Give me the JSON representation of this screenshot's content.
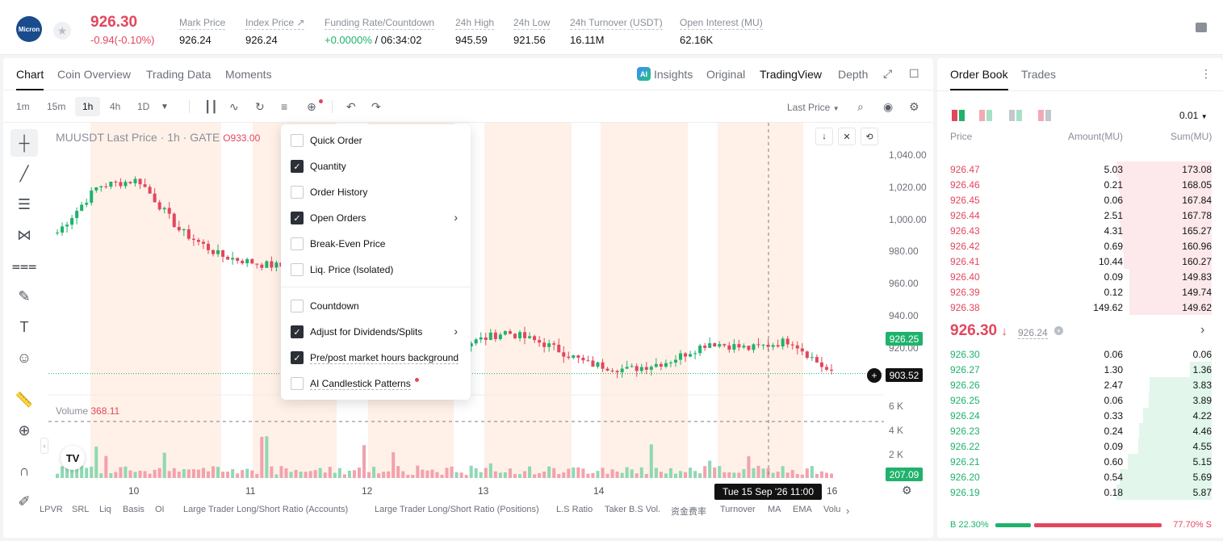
{
  "header": {
    "logo_text": "Micron",
    "price": "926.30",
    "change": "-0.94(-0.10%)",
    "stats": [
      {
        "label": "Mark Price",
        "value": "926.24"
      },
      {
        "label": "Index Price ↗",
        "value": "926.24"
      },
      {
        "label": "Funding Rate/Countdown",
        "value_green": "+0.0000%",
        "value": " / 06:34:02"
      },
      {
        "label": "24h High",
        "value": "945.59"
      },
      {
        "label": "24h Low",
        "value": "921.56"
      },
      {
        "label": "24h Turnover (USDT)",
        "value": "16.11M"
      },
      {
        "label": "Open Interest (MU)",
        "value": "62.16K"
      }
    ]
  },
  "chart_tabs": [
    "Chart",
    "Coin Overview",
    "Trading Data",
    "Moments"
  ],
  "chart_tabs_right": {
    "ai": "AI",
    "insights": "Insights",
    "original": "Original",
    "tradingview": "TradingView",
    "depth": "Depth"
  },
  "timeframes": [
    "1m",
    "15m",
    "1h",
    "4h",
    "1D"
  ],
  "last_price_select": "Last Price",
  "chart": {
    "title_main": "MUUSDT Last Price · 1h · GATE",
    "title_o": "O933.00",
    "volume_label": "Volume",
    "volume_value": "368.11",
    "price_ticks": [
      "1,040.00",
      "1,020.00",
      "1,000.00",
      "980.00",
      "960.00",
      "940.00",
      "920.00"
    ],
    "vol_ticks": [
      "6 K",
      "4 K",
      "2 K"
    ],
    "last_price_tag": "926.25",
    "cross_price_tag": "903.52",
    "vol_tag": "207.09",
    "date_ticks": [
      "10",
      "11",
      "12",
      "13",
      "14",
      "16"
    ],
    "crosshair_time": "Tue 15 Sep '26   11:00",
    "indicators": [
      "LPVR",
      "SRL",
      "Liq",
      "Basis",
      "OI",
      "Large Trader Long/Short Ratio (Accounts)",
      "Large Trader Long/Short Ratio (Positions)",
      "L.S Ratio",
      "Taker B.S Vol.",
      "资金费率",
      "Turnover",
      "MA",
      "EMA",
      "Volu"
    ]
  },
  "chart_data": {
    "type": "candlestick",
    "x": [
      "Day 10",
      "Day 11",
      "Day 12",
      "Day 13",
      "Day 14",
      "Day 15",
      "Day 16"
    ],
    "ylim": [
      915,
      1045
    ],
    "close_series": [
      993,
      1015,
      1018,
      994,
      982,
      978,
      976,
      972,
      966,
      943,
      940,
      946,
      940,
      931,
      928,
      932,
      941,
      938,
      942,
      926
    ],
    "volume_ylim": [
      0,
      7000
    ]
  },
  "menu": {
    "items": [
      {
        "label": "Quick Order",
        "checked": false
      },
      {
        "label": "Quantity",
        "checked": true
      },
      {
        "label": "Order History",
        "checked": false
      },
      {
        "label": "Open Orders",
        "checked": true
      },
      {
        "label": "Break-Even Price",
        "checked": false
      },
      {
        "label": "Liq. Price (Isolated)",
        "checked": false
      },
      {
        "label": "Countdown",
        "checked": false
      },
      {
        "label": "Adjust for Dividends/Splits",
        "checked": true
      },
      {
        "label": "Pre/post market hours background",
        "checked": true
      },
      {
        "label": "AI Candlestick Patterns",
        "checked": false
      }
    ]
  },
  "orderbook": {
    "tabs": [
      "Order Book",
      "Trades"
    ],
    "precision": "0.01",
    "headers": [
      "Price",
      "Amount(MU)",
      "Sum(MU)"
    ],
    "asks": [
      [
        "926.47",
        "5.03",
        "173.08"
      ],
      [
        "926.46",
        "0.21",
        "168.05"
      ],
      [
        "926.45",
        "0.06",
        "167.84"
      ],
      [
        "926.44",
        "2.51",
        "167.78"
      ],
      [
        "926.43",
        "4.31",
        "165.27"
      ],
      [
        "926.42",
        "0.69",
        "160.96"
      ],
      [
        "926.41",
        "10.44",
        "160.27"
      ],
      [
        "926.40",
        "0.09",
        "149.83"
      ],
      [
        "926.39",
        "0.12",
        "149.74"
      ],
      [
        "926.38",
        "149.62",
        "149.62"
      ]
    ],
    "mid_price": "926.30",
    "mid_arrow": "↓",
    "mark_price": "926.24",
    "bids": [
      [
        "926.30",
        "0.06",
        "0.06"
      ],
      [
        "926.27",
        "1.30",
        "1.36"
      ],
      [
        "926.26",
        "2.47",
        "3.83"
      ],
      [
        "926.25",
        "0.06",
        "3.89"
      ],
      [
        "926.24",
        "0.33",
        "4.22"
      ],
      [
        "926.23",
        "0.24",
        "4.46"
      ],
      [
        "926.22",
        "0.09",
        "4.55"
      ],
      [
        "926.21",
        "0.60",
        "5.15"
      ],
      [
        "926.20",
        "0.54",
        "5.69"
      ],
      [
        "926.19",
        "0.18",
        "5.87"
      ]
    ],
    "buy_ratio": "B 22.30%",
    "sell_ratio": "77.70% S",
    "buy_fraction": 0.223
  },
  "colors": {
    "up": "#20b26c",
    "down": "#e2475d",
    "session_bg": "#fff1e8"
  }
}
